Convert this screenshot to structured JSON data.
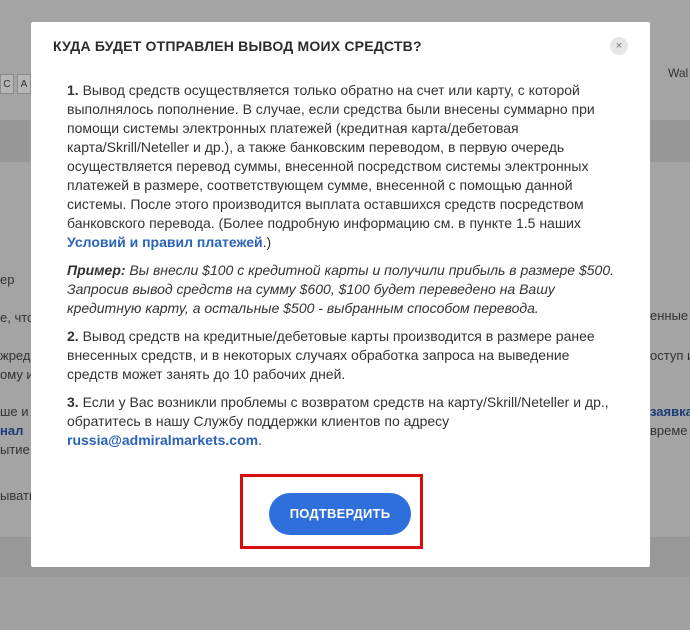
{
  "background": {
    "header_right_text": "Wal",
    "button_left_1": "C",
    "button_left_2": "A",
    "fragments_left": [
      "ер",
      "е, что",
      "жред",
      "ому и",
      "ше и",
      "нал",
      "ытие",
      "ывать"
    ],
    "fragments_right": [
      "енные",
      "оступ и",
      "заявка",
      "време"
    ]
  },
  "modal": {
    "title": "КУДА БУДЕТ ОТПРАВЛЕН ВЫВОД МОИХ СРЕДСТВ?",
    "close_glyph": "×",
    "p1_num": "1.",
    "p1_text": " Вывод средств осуществляется только обратно на счет или карту, с которой выполнялось пополнение. В случае, если средства были внесены суммарно при помощи системы электронных платежей (кредитная карта/дебетовая карта/Skrill/Neteller и др.), а также банковским переводом, в первую очередь осуществляется перевод суммы, внесенной посредством системы электронных платежей в размере, соответствующем сумме, внесенной с помощью данной системы. После этого производится выплата оставшихся средств посредством банковского перевода. (Более подробную информацию см. в пункте 1.5 наших ",
    "p1_link": "Условий и правил платежей",
    "p1_end": ".)",
    "example_label": "Пример:",
    "example_text": " Вы внесли $100 с кредитной карты и получили прибыль в размере $500. Запросив вывод средств на сумму $600, $100 будет переведено на Вашу кредитную карту, а остальные $500 - выбранным способом перевода.",
    "p2_num": "2.",
    "p2_text": " Вывод средств на кредитные/дебетовые карты производится в размере ранее внесенных средств, и в некоторых случаях обработка запроса на выведение средств может занять до 10 рабочих дней.",
    "p3_num": "3.",
    "p3_text": " Если у Вас возникли проблемы с возвратом средств на карту/Skrill/Neteller и др., обратитесь в нашу Службу поддержки клиентов по адресу ",
    "p3_email": "russia@admiralmarkets.com",
    "p3_end": ".",
    "confirm_label": "ПОДТВЕРДИТЬ"
  },
  "colors": {
    "accent": "#2f6fdc",
    "highlight": "#d90d0d",
    "link": "#2a63b8"
  }
}
